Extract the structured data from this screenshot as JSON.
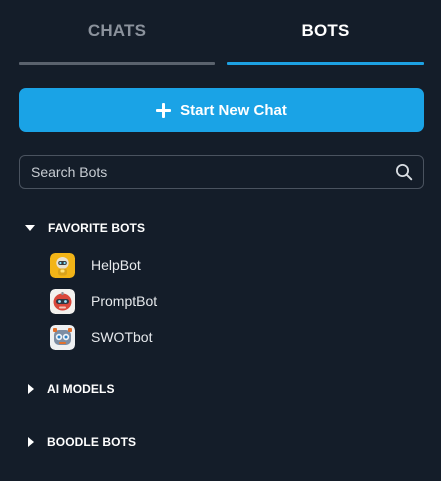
{
  "tabs": [
    {
      "label": "CHATS",
      "active": false
    },
    {
      "label": "BOTS",
      "active": true
    }
  ],
  "new_chat": {
    "label": "Start New Chat",
    "icon": "plus-icon"
  },
  "search": {
    "placeholder": "Search Bots",
    "value": "",
    "icon": "search-icon"
  },
  "sections": {
    "favorite": {
      "label": "FAVORITE BOTS",
      "expanded": true,
      "items": [
        {
          "label": "HelpBot",
          "icon": "helpbot-avatar"
        },
        {
          "label": "PromptBot",
          "icon": "promptbot-avatar"
        },
        {
          "label": "SWOTbot",
          "icon": "swotbot-avatar"
        }
      ]
    },
    "ai_models": {
      "label": "AI MODELS",
      "expanded": false
    },
    "boodle_bots": {
      "label": "BOODLE BOTS",
      "expanded": false
    }
  },
  "colors": {
    "background": "#141d29",
    "accent": "#1aa3e6",
    "inactive_tab": "#8b929c"
  }
}
